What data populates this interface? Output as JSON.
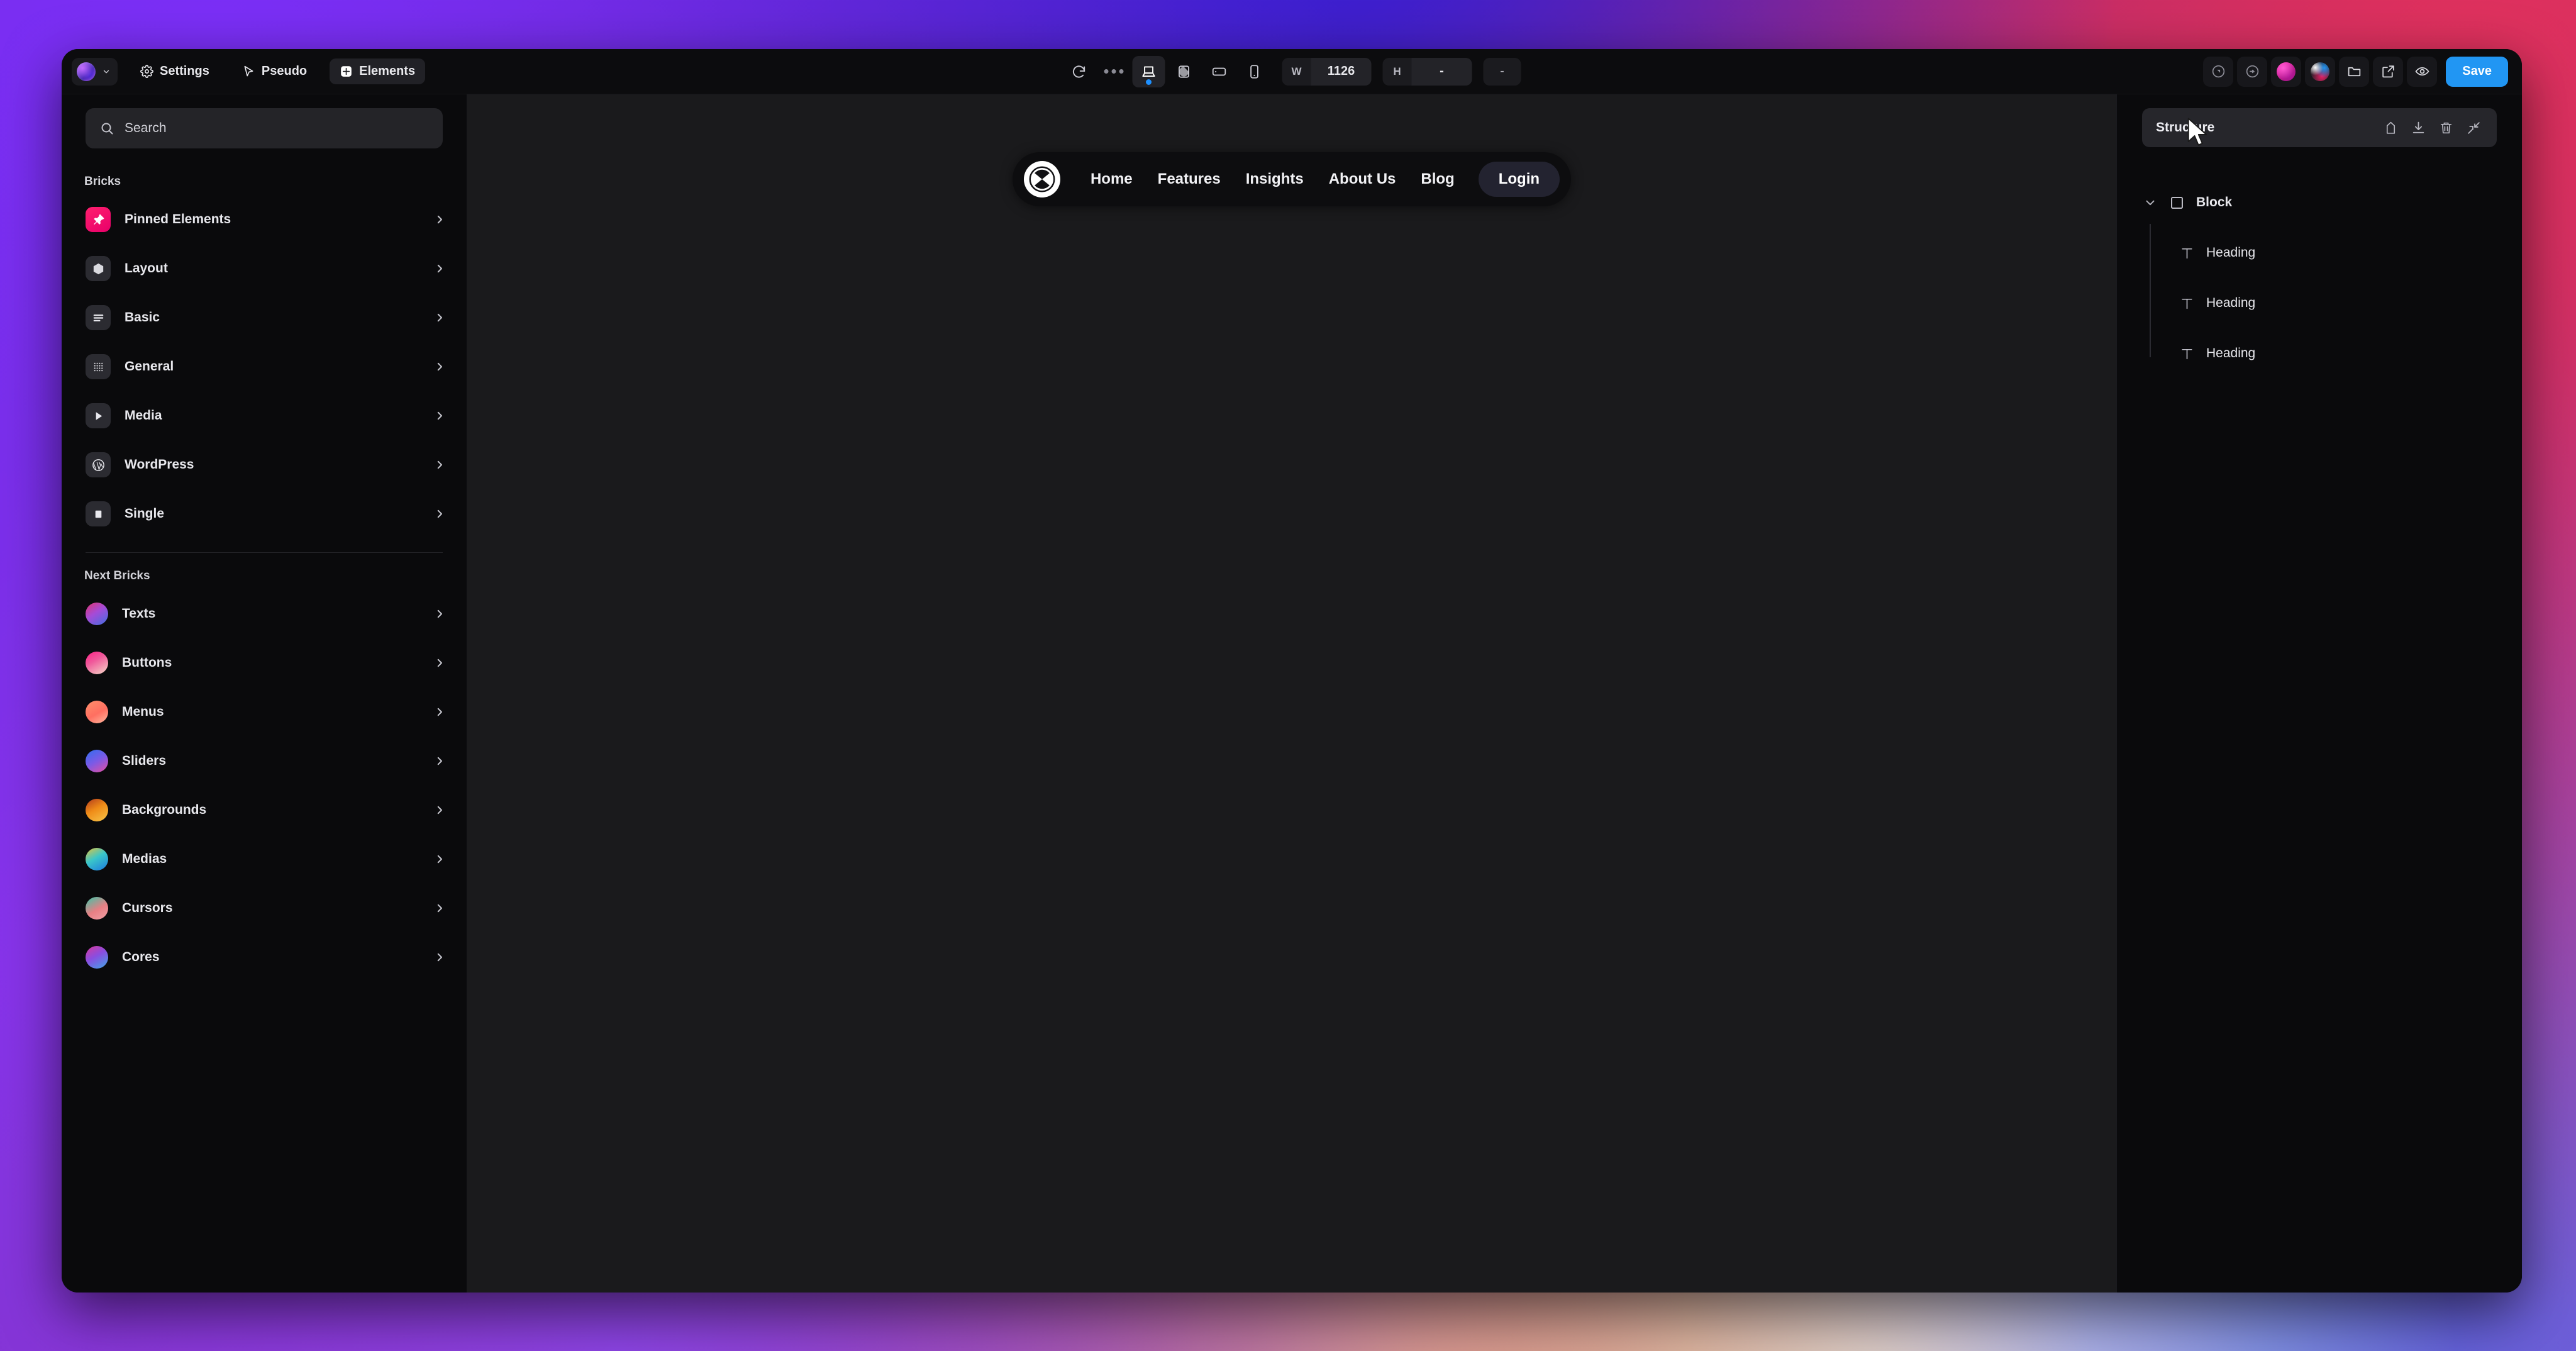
{
  "topbar": {
    "brand_name": "bricks-logo",
    "tabs": [
      {
        "label": "Settings",
        "icon": "gear-icon",
        "active": false
      },
      {
        "label": "Pseudo",
        "icon": "cursor-arrow-icon",
        "active": false
      },
      {
        "label": "Elements",
        "icon": "plus-square-icon",
        "active": true
      }
    ],
    "devices": [
      {
        "name": "refresh-icon"
      },
      {
        "name": "more-dots-icon"
      },
      {
        "name": "desktop-icon",
        "active": true
      },
      {
        "name": "tablet-portrait-icon",
        "active": false
      },
      {
        "name": "tablet-landscape-icon",
        "active": false
      },
      {
        "name": "mobile-icon",
        "active": false
      }
    ],
    "width_label": "W",
    "width_value": "1126",
    "height_label": "H",
    "height_value": "-",
    "extra_value": "-",
    "right_icons": [
      "play-circle-icon",
      "target-circle-icon",
      "pink-orb-icon",
      "multicolor-orb-icon",
      "folder-icon",
      "external-link-icon",
      "eye-icon"
    ],
    "save_label": "Save",
    "save_color": "#2196f3"
  },
  "search": {
    "placeholder": "Search",
    "icon": "search-icon"
  },
  "sidebar": {
    "sections": [
      {
        "title": "Bricks",
        "items": [
          {
            "label": "Pinned Elements",
            "icon": "pin-icon",
            "style": "pink"
          },
          {
            "label": "Layout",
            "icon": "cube-icon",
            "style": "grey"
          },
          {
            "label": "Basic",
            "icon": "lines-icon",
            "style": "grey"
          },
          {
            "label": "General",
            "icon": "grid-dots-icon",
            "style": "grey"
          },
          {
            "label": "Media",
            "icon": "play-icon",
            "style": "grey"
          },
          {
            "label": "WordPress",
            "icon": "wordpress-icon",
            "style": "grey"
          },
          {
            "label": "Single",
            "icon": "square-icon",
            "style": "grey"
          }
        ]
      },
      {
        "title": "Next Bricks",
        "items": [
          {
            "label": "Texts",
            "icon": "gradient-orb-icon",
            "style": "g-texts"
          },
          {
            "label": "Buttons",
            "icon": "gradient-orb-icon",
            "style": "g-buttons"
          },
          {
            "label": "Menus",
            "icon": "gradient-orb-icon",
            "style": "g-menus"
          },
          {
            "label": "Sliders",
            "icon": "gradient-orb-icon",
            "style": "g-sliders"
          },
          {
            "label": "Backgrounds",
            "icon": "gradient-orb-icon",
            "style": "g-bg"
          },
          {
            "label": "Medias",
            "icon": "gradient-orb-icon",
            "style": "g-medias"
          },
          {
            "label": "Cursors",
            "icon": "gradient-orb-icon",
            "style": "g-cursors"
          },
          {
            "label": "Cores",
            "icon": "gradient-orb-icon",
            "style": "g-cores"
          }
        ]
      }
    ]
  },
  "canvas": {
    "site_nav": {
      "logo_icon": "x-circle-logo",
      "links": [
        "Home",
        "Features",
        "Insights",
        "About Us",
        "Blog"
      ],
      "cta_label": "Login"
    }
  },
  "structure": {
    "title": "Structure",
    "actions": [
      "label-icon",
      "download-icon",
      "trash-icon",
      "collapse-icon"
    ],
    "tree": {
      "root_label": "Block",
      "root_icon": "square-outline-icon",
      "children": [
        {
          "label": "Heading",
          "icon": "text-t-icon"
        },
        {
          "label": "Heading",
          "icon": "text-t-icon"
        },
        {
          "label": "Heading",
          "icon": "text-t-icon"
        }
      ]
    }
  }
}
